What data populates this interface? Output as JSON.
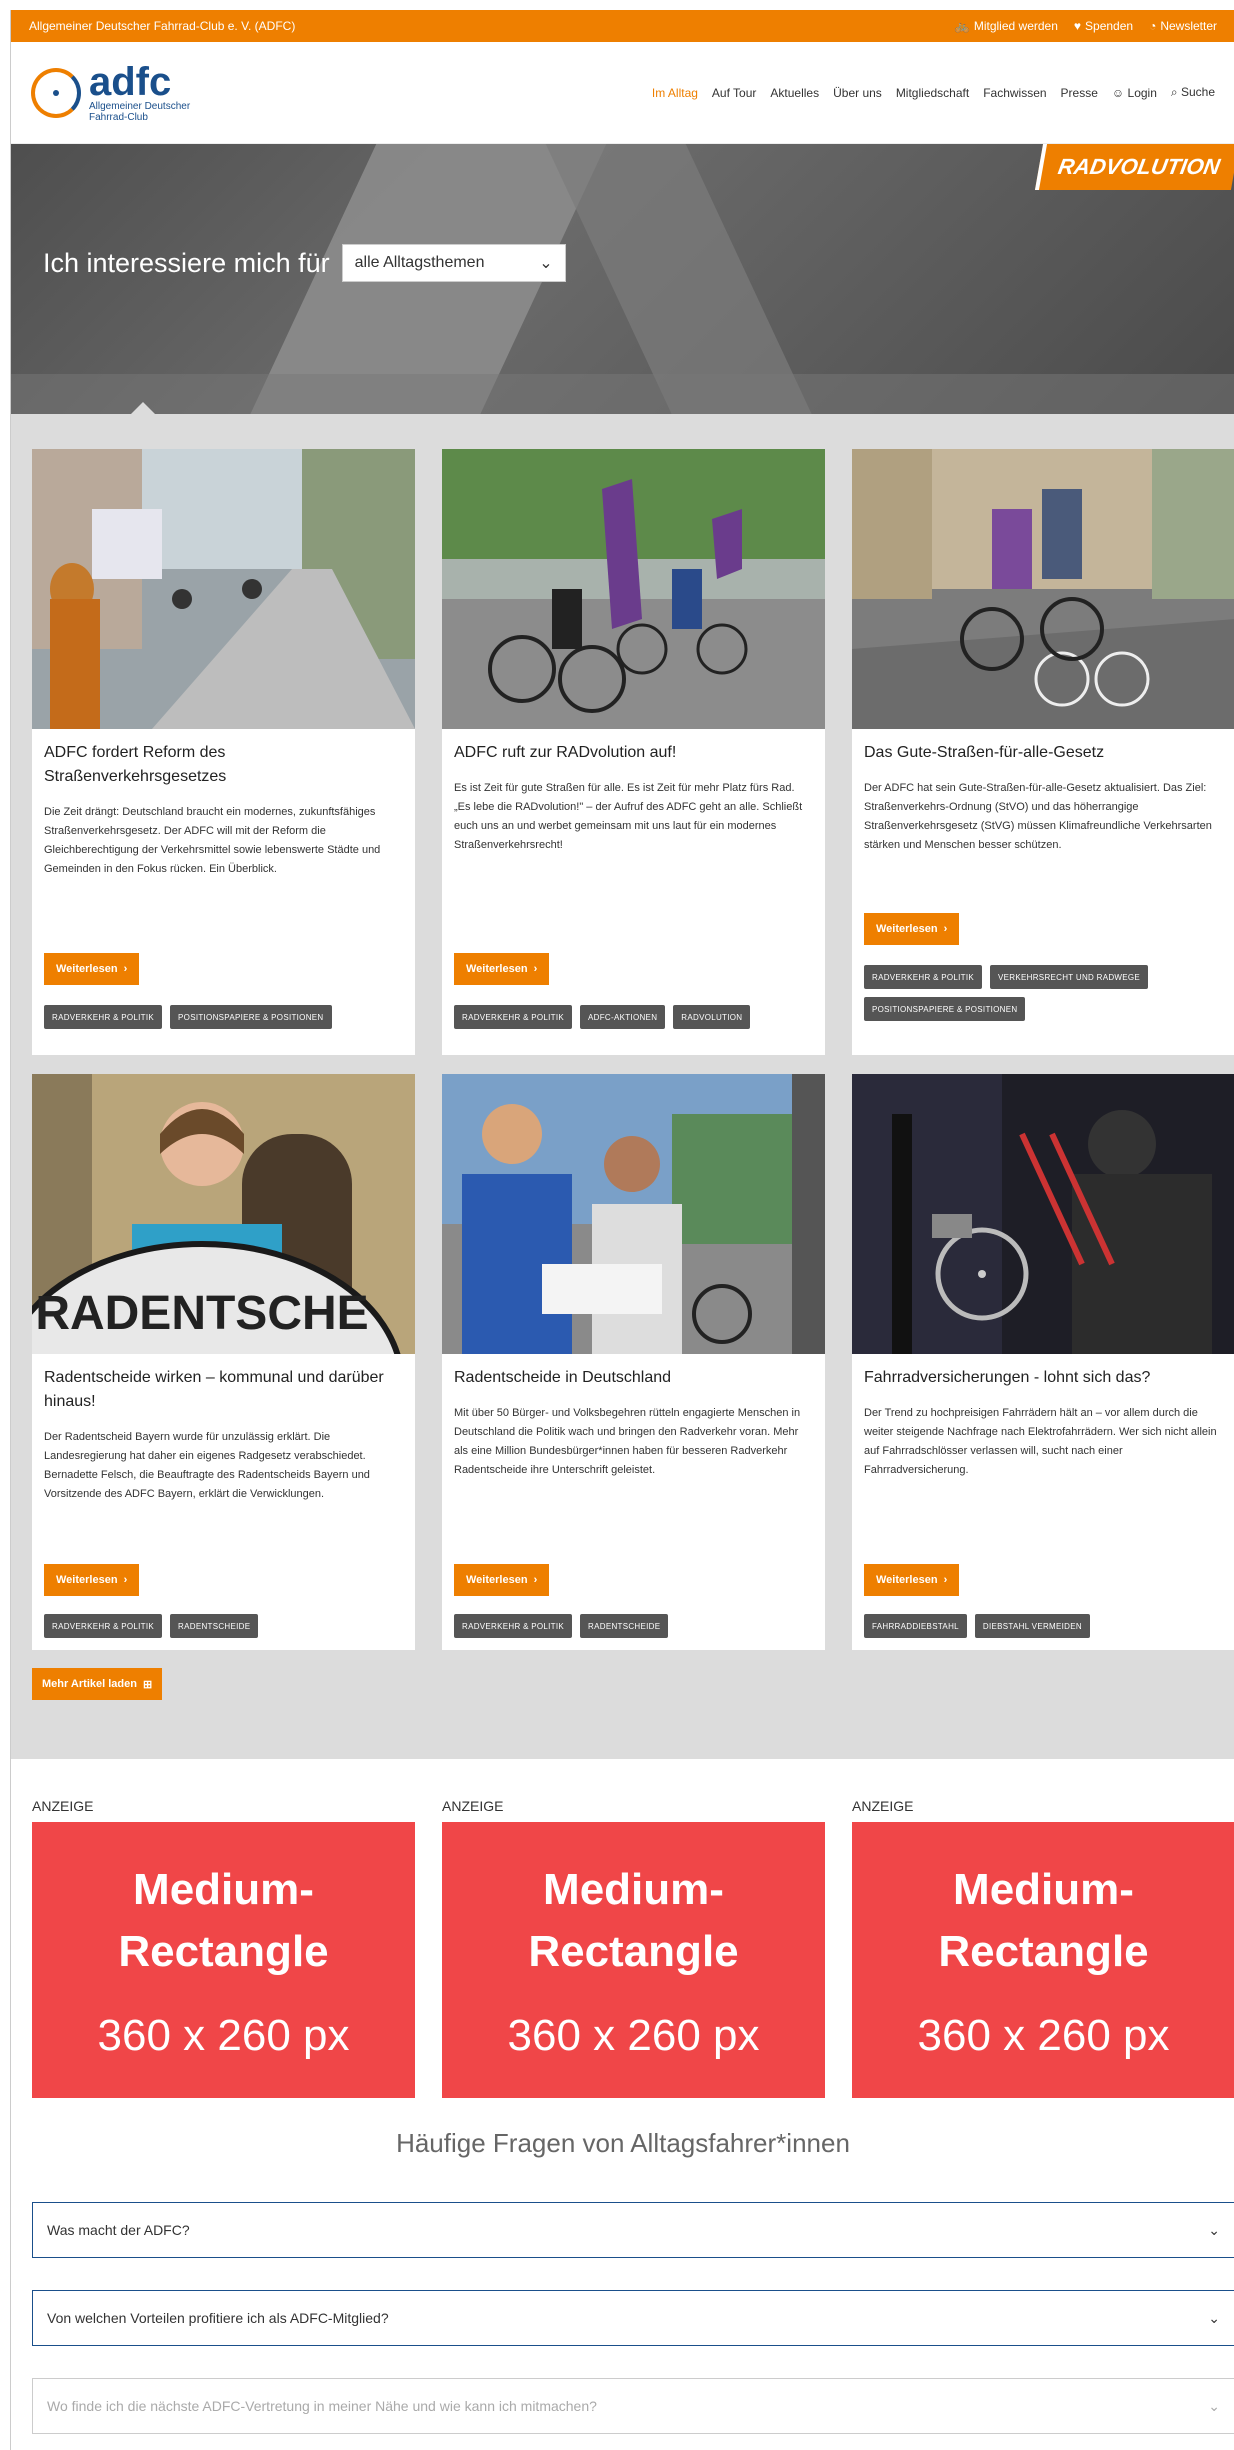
{
  "topbar": {
    "org_name": "Allgemeiner Deutscher Fahrrad-Club e. V. (ADFC)",
    "links": [
      {
        "icon": "bike-icon",
        "label": "Mitglied werden"
      },
      {
        "icon": "heart-icon",
        "label": "Spenden"
      },
      {
        "icon": "bell-icon",
        "label": "Newsletter"
      }
    ]
  },
  "header": {
    "logo_word": "adfc",
    "logo_sub_1": "Allgemeiner Deutscher",
    "logo_sub_2": "Fahrrad-Club",
    "nav": [
      "Im Alltag",
      "Auf Tour",
      "Aktuelles",
      "Über uns",
      "Mitgliedschaft",
      "Fachwissen",
      "Presse",
      "Login",
      "Suche"
    ]
  },
  "hero": {
    "badge": "RADVOLUTION",
    "interest_label": "Ich interessiere mich für",
    "select_value": "alle Alltagsthemen"
  },
  "cards": [
    {
      "title": "ADFC fordert Reform des Straßenverkehrsgesetzes",
      "text": "Die Zeit drängt: Deutschland braucht ein modernes, zukunftsfähiges Straßenverkehrsgesetz. Der ADFC will mit der Reform die Gleichberechtigung der Verkehrsmittel sowie lebenswerte Städte und Gemeinden in den Fokus rücken. Ein Überblick.",
      "more": "Weiterlesen",
      "tags": [
        "RADVERKEHR & POLITIK",
        "POSITIONSPAPIERE & POSITIONEN"
      ]
    },
    {
      "title": "ADFC ruft zur RADvolution auf!",
      "text": "Es ist Zeit für gute Straßen für alle. Es ist Zeit für mehr Platz fürs Rad. „Es lebe die RADvolution!\" – der Aufruf des ADFC geht an alle. Schließt euch uns an und werbet gemeinsam mit uns laut für ein modernes Straßenverkehrsrecht!",
      "more": "Weiterlesen",
      "tags": [
        "RADVERKEHR & POLITIK",
        "ADFC-AKTIONEN",
        "RADVOLUTION"
      ]
    },
    {
      "title": "Das Gute-Straßen-für-alle-Gesetz",
      "text": "Der ADFC hat sein Gute-Straßen-für-alle-Gesetz aktualisiert. Das Ziel: Straßenverkehrs-Ordnung (StVO) und das höherrangige Straßenverkehrsgesetz (StVG) müssen Klimafreundliche Verkehrsarten stärken und Menschen besser schützen.",
      "more": "Weiterlesen",
      "tags": [
        "RADVERKEHR & POLITIK",
        "VERKEHRSRECHT UND RADWEGE",
        "POSITIONSPAPIERE & POSITIONEN"
      ]
    },
    {
      "title": "Radentscheide wirken – kommunal und darüber hinaus!",
      "text": "Der Radentscheid Bayern wurde für unzulässig erklärt. Die Landesregierung hat daher ein eigenes Radgesetz verabschiedet. Bernadette Felsch, die Beauftragte des Radentscheids Bayern und Vorsitzende des ADFC Bayern, erklärt die Verwicklungen.",
      "more": "Weiterlesen",
      "tags": [
        "RADVERKEHR & POLITIK",
        "RADENTSCHEIDE"
      ]
    },
    {
      "title": "Radentscheide in Deutschland",
      "text": "Mit über 50 Bürger- und Volksbegehren rütteln engagierte Menschen in Deutschland die Politik wach und bringen den Radverkehr voran. Mehr als eine Million Bundesbürger*innen haben für besseren Radverkehr Radentscheide ihre Unterschrift geleistet.",
      "more": "Weiterlesen",
      "tags": [
        "RADVERKEHR & POLITIK",
        "RADENTSCHEIDE"
      ]
    },
    {
      "title": "Fahrradversicherungen - lohnt sich das?",
      "text": "Der Trend zu hochpreisigen Fahrrädern hält an – vor allem durch die weiter steigende Nachfrage nach Elektrofahrrädern. Wer sich nicht allein auf Fahrradschlösser verlassen will, sucht nach einer Fahrradversicherung.",
      "more": "Weiterlesen",
      "tags": [
        "FAHRRADDIEBSTAHL",
        "DIEBSTAHL VERMEIDEN"
      ]
    }
  ],
  "more_articles": "Mehr Artikel laden",
  "ads": [
    {
      "label": "ANZEIGE",
      "title": "Medium-Rectangle",
      "size": "360 x 260 px"
    },
    {
      "label": "ANZEIGE",
      "title": "Medium-Rectangle",
      "size": "360 x 260 px"
    },
    {
      "label": "ANZEIGE",
      "title": "Medium-Rectangle",
      "size": "360 x 260 px"
    }
  ],
  "faq": {
    "title": "Häufige Fragen von Alltagsfahrer*innen",
    "items": [
      "Was macht der ADFC?",
      "Von welchen Vorteilen profitiere ich als ADFC-Mitglied?",
      "Wo finde ich die nächste ADFC-Vertretung in meiner Nähe und wie kann ich mitmachen?"
    ]
  },
  "colors": {
    "accent": "#ee7f00",
    "brand": "#1a4f8b",
    "ad_red": "#f04648",
    "tag_gray": "#555555"
  }
}
